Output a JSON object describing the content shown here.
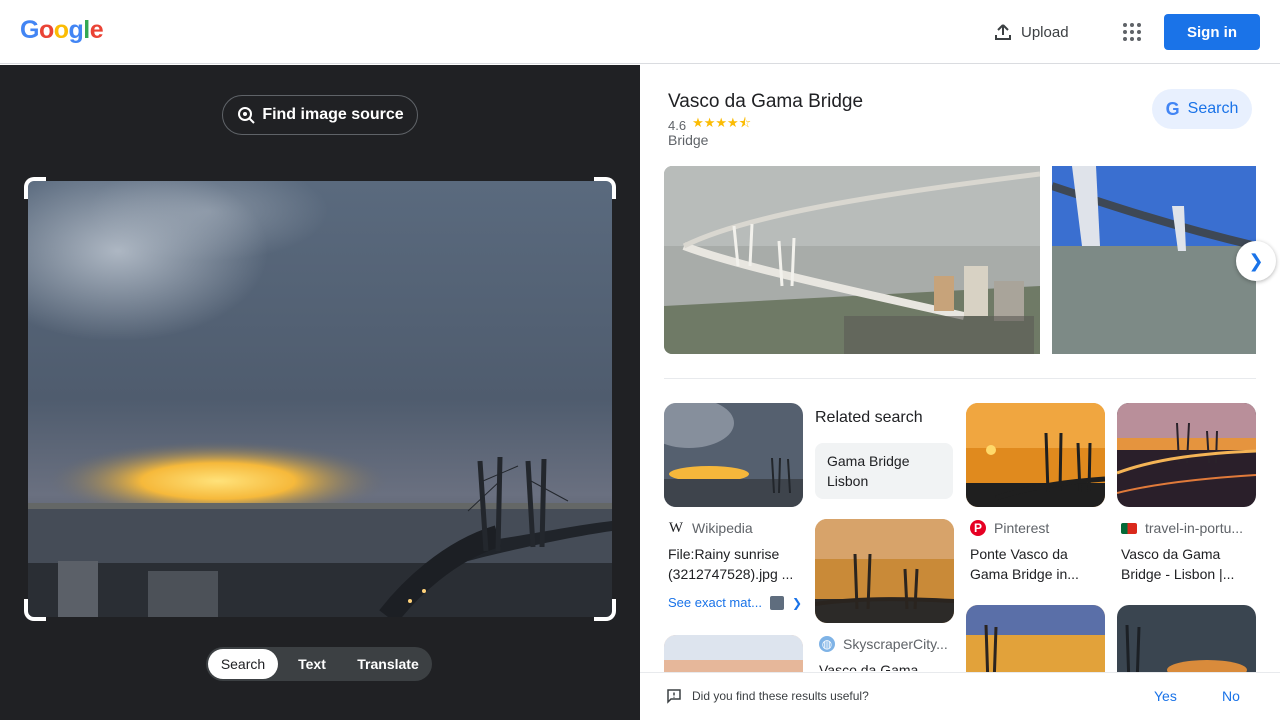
{
  "header": {
    "logo_letters": [
      "G",
      "o",
      "o",
      "g",
      "l",
      "e"
    ],
    "logo_colors": [
      "#4285f4",
      "#ea4335",
      "#fbbc05",
      "#4285f4",
      "#34a853",
      "#ea4335"
    ],
    "upload_label": "Upload",
    "apps_icon": "apps-grid-icon",
    "signin_label": "Sign in"
  },
  "lens": {
    "find_source_label": "Find image source",
    "modes": [
      "Search",
      "Text",
      "Translate"
    ],
    "active_mode": "Search"
  },
  "knowledge_panel": {
    "title": "Vasco da Gama Bridge",
    "rating": "4.6",
    "stars": "★★★★⯪",
    "type": "Bridge",
    "search_button": "Search"
  },
  "results": {
    "related_title": "Related search",
    "related_chip": "Gama Bridge Lisbon",
    "items": [
      {
        "source": "Wikipedia",
        "caption": "File:Rainy sunrise (3212747528).jpg ...",
        "favicon": "W"
      },
      {
        "source": "SkyscraperCity...",
        "caption": "Vasco da Gama ...",
        "favicon": "◍"
      },
      {
        "source": "Pinterest",
        "caption": "Ponte Vasco da Gama Bridge in...",
        "favicon": "P"
      },
      {
        "source": "travel-in-portu...",
        "caption": "Vasco da Gama Bridge - Lisbon |...",
        "favicon": "flag"
      }
    ],
    "see_exact": "See exact mat..."
  },
  "feedback": {
    "question": "Did you find these results useful?",
    "yes": "Yes",
    "no": "No"
  }
}
